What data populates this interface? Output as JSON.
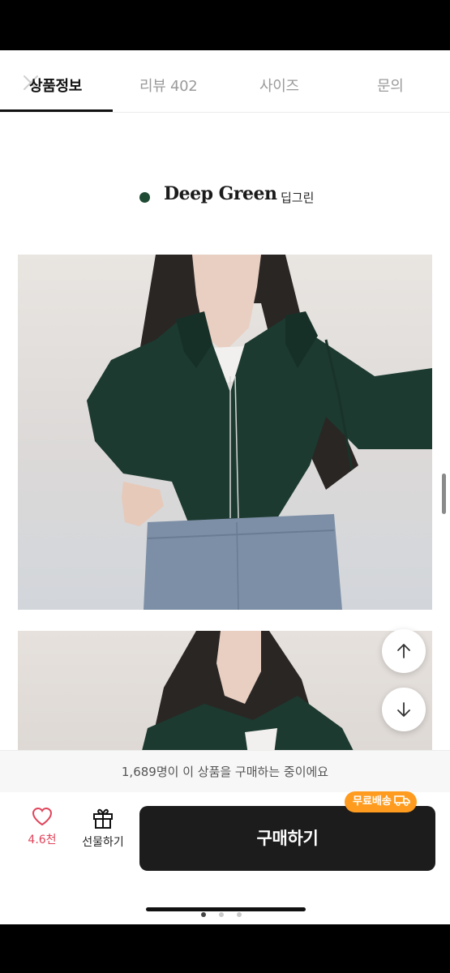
{
  "tabs": [
    {
      "label": "상품정보",
      "active": true
    },
    {
      "label": "리뷰 402",
      "active": false
    },
    {
      "label": "사이즈",
      "active": false
    },
    {
      "label": "문의",
      "active": false
    }
  ],
  "product": {
    "color_name": "Deep Green",
    "color_sub": "딥그린",
    "color_hex": "#1f4a33"
  },
  "notice": {
    "text": "1,689명이 이 상품을 구매하는 중이에요"
  },
  "bottom": {
    "like_count": "4.6천",
    "gift_label": "선물하기",
    "buy_label": "구매하기",
    "free_shipping_badge": "무료배송"
  },
  "colors": {
    "like": "#e0445a",
    "buy_button": "#1c1c1c",
    "badge": "#ff9c1f"
  },
  "icons": [
    "close-icon",
    "arrow-up-icon",
    "arrow-down-icon",
    "heart-icon",
    "gift-icon",
    "truck-icon"
  ]
}
